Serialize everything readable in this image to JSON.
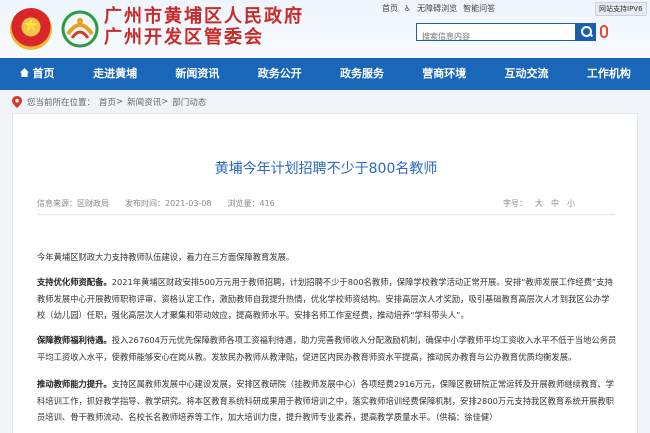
{
  "header": {
    "title_line1": "广州市黄埔区人民政府",
    "title_line2": "广州开发区管委会",
    "links": [
      "首页",
      "无障碍浏览",
      "智能问答"
    ],
    "ipv6_badge": "网站支持IPV6",
    "search_placeholder": "搜索信息内容",
    "icons": [
      "emblem-icon",
      "district-logo-icon",
      "search-icon",
      "microphone-icon",
      "accessibility-icon"
    ]
  },
  "nav": [
    "首页",
    "走进黄埔",
    "新闻资讯",
    "政务公开",
    "政务服务",
    "营商环境",
    "互动交流",
    "工作机构"
  ],
  "breadcrumb": {
    "prefix": "您当前所在位置：",
    "items": [
      "首页",
      "新闻资讯",
      "部门动态"
    ],
    "sep": ">"
  },
  "article": {
    "title": "黄埔今年计划招聘不少于800名教师",
    "meta": {
      "source": "信息来源：区财政局",
      "published": "发布时间：2021-03-08",
      "views": "浏览量：416"
    },
    "tools": [
      "字号：",
      "大",
      "中",
      "小"
    ],
    "paragraphs": [
      {
        "lead": "",
        "text": "今年黄埔区财政大力支持教师队伍建设，着力在三方面保障教育发展。"
      },
      {
        "lead": "支持优化师资配备。",
        "text": "2021年黄埔区财政安排500万元用于教师招聘，计划招聘不少于800名教师，保障学校教学活动正常开展。安排“教师发展工作经费”支持教师发展中心开展教师职称评审、资格认定工作，激励教师自我提升热情，优化学校师资结构。安排高层次人才奖励，吸引基础教育高层次人才到我区公办学校（幼儿园）任职，强化高层次人才聚集和带动效应，提高教师水平。安排名师工作室经费，推动培养“学科带头人”。"
      },
      {
        "lead": "保障教师福利待遇。",
        "text": "投入267604万元优先保障教师各项工资福利待遇，助力完善教师收入分配激励机制，确保中小学教师平均工资收入水平不低于当地公务员平均工资收入水平，使教师能够安心在岗从教。发放民办教师从教津贴，促进区内民办教育师资水平提高，推动民办教育与公办教育优质均衡发展。"
      },
      {
        "lead": "推动教师能力提升。",
        "text": "支持区属教师发展中心建设发展，安排区教研院（挂教师发展中心）各项经费2916万元，保障区教研院正常运转及开展教师继续教育、学科培训工作，抓好教学指导、教学研究。将本区教育系统科研成果用于教师培训之中，落实教师培训经费保障机制，安排2800万元支持我区教育系统开展教职员培训、骨干教师流动、名校长名教师培养等工作，加大培训力度，提升教师专业素养，提高教学质量水平。（供稿：徐佳健）"
      }
    ]
  }
}
